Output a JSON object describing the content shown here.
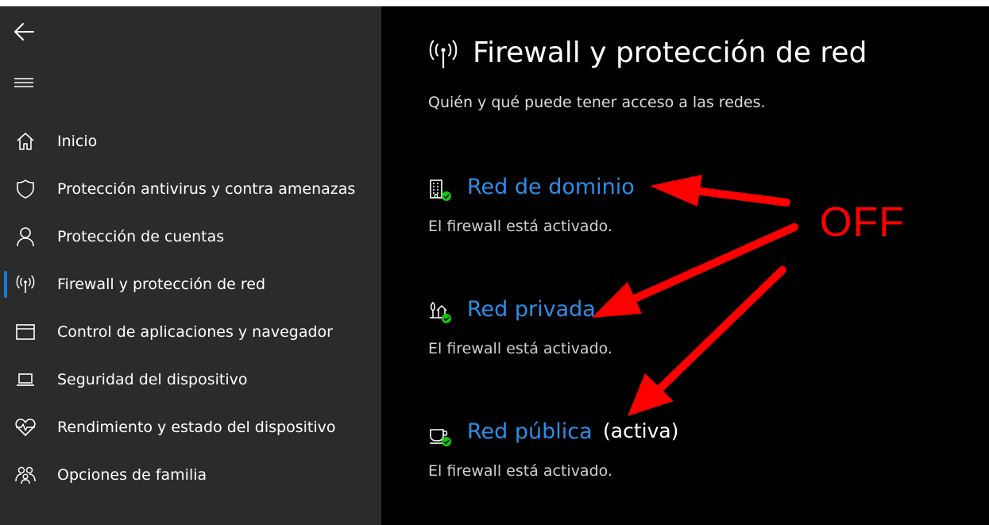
{
  "sidebar": {
    "items": [
      {
        "label": "Inicio",
        "icon": "home-icon"
      },
      {
        "label": "Protección antivirus y contra amenazas",
        "icon": "shield-icon"
      },
      {
        "label": "Protección de cuentas",
        "icon": "person-icon"
      },
      {
        "label": "Firewall y protección de red",
        "icon": "antenna-icon",
        "active": true
      },
      {
        "label": "Control de aplicaciones y navegador",
        "icon": "app-browser-icon"
      },
      {
        "label": "Seguridad del dispositivo",
        "icon": "laptop-icon"
      },
      {
        "label": "Rendimiento y estado del dispositivo",
        "icon": "heart-pulse-icon"
      },
      {
        "label": "Opciones de familia",
        "icon": "family-icon"
      }
    ]
  },
  "main": {
    "title": "Firewall y protección de red",
    "subtitle": "Quién y qué puede tener acceso a las redes.",
    "networks": [
      {
        "name": "Red de dominio",
        "extra": "",
        "status": "El firewall está activado.",
        "icon": "domain-building-icon"
      },
      {
        "name": "Red privada",
        "extra": "",
        "status": "El firewall está activado.",
        "icon": "private-house-icon"
      },
      {
        "name": "Red pública",
        "extra": "(activa)",
        "status": "El firewall está activado.",
        "icon": "public-cafe-icon"
      }
    ]
  },
  "annotation": {
    "label": "OFF",
    "color": "#ff0000"
  },
  "colors": {
    "accent": "#2b8fe8",
    "sidebar_bg": "#2b2b2b",
    "main_bg": "#000000",
    "check_green": "#16c60c"
  }
}
